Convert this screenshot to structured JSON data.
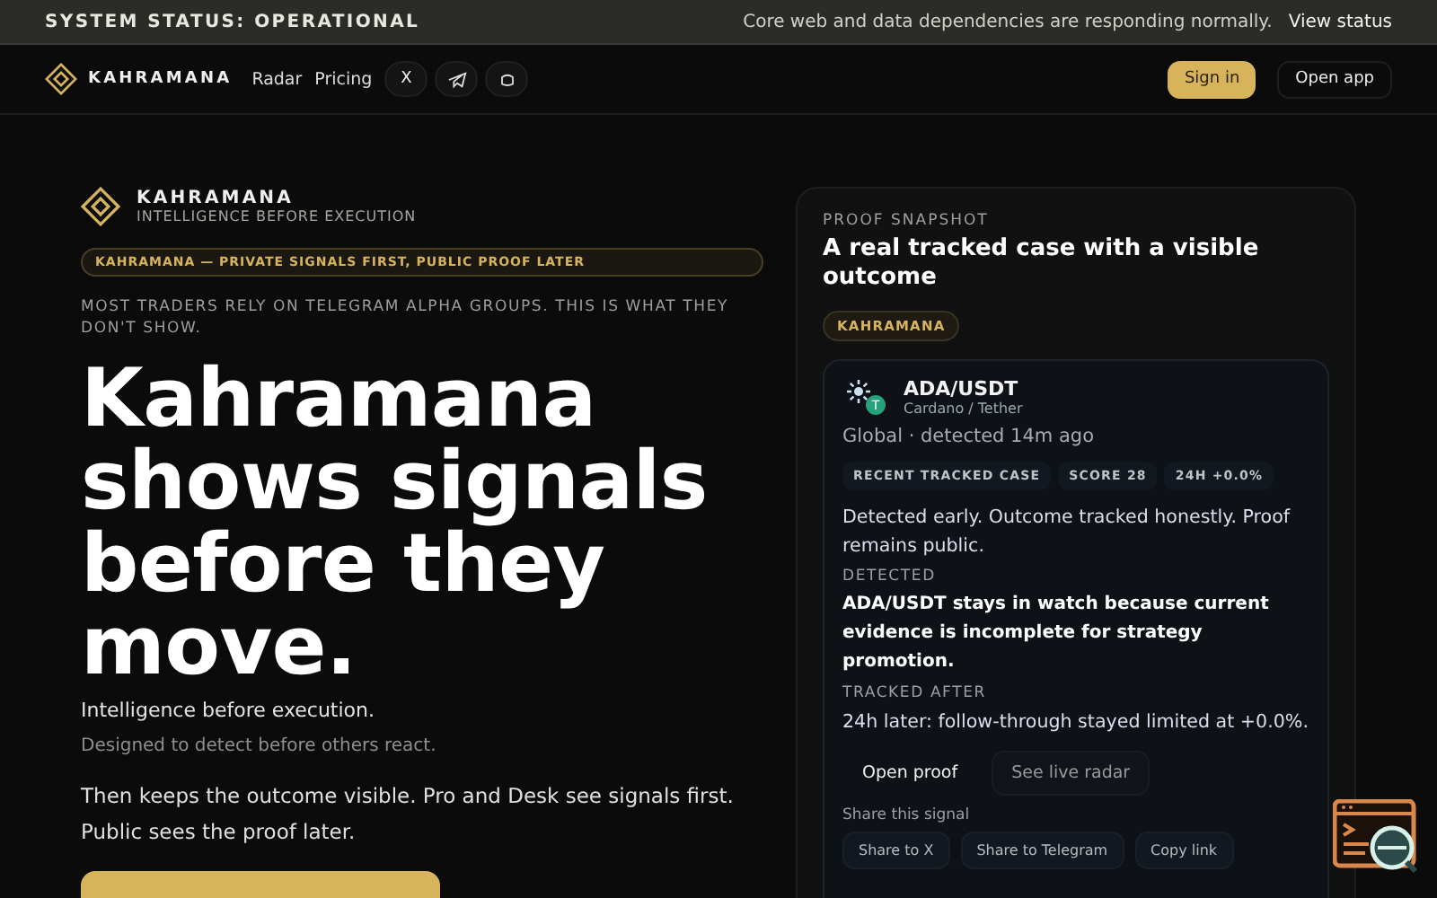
{
  "status_bar": {
    "label": "SYSTEM STATUS: OPERATIONAL",
    "message": "Core web and data dependencies are responding normally.",
    "link": "View status"
  },
  "nav": {
    "brand": "KAHRAMANA",
    "links": [
      "Radar",
      "Pricing"
    ],
    "social": [
      {
        "kind": "x",
        "label": "X"
      },
      {
        "kind": "telegram"
      },
      {
        "kind": "discord"
      }
    ],
    "sign_in": "Sign in",
    "open_app": "Open app"
  },
  "hero": {
    "brand": "KAHRAMANA",
    "tagline": "INTELLIGENCE BEFORE EXECUTION",
    "pill": "KAHRAMANA — PRIVATE SIGNALS FIRST, PUBLIC PROOF LATER",
    "eyebrow": "MOST TRADERS RELY ON TELEGRAM ALPHA GROUPS. THIS IS WHAT THEY DON'T SHOW.",
    "headline": "Kahramana shows signals before they move.",
    "sub": "Intelligence before execution.",
    "note": "Designed to detect before others react.",
    "body": "Then keeps the outcome visible. Pro and Desk see signals first. Public sees the proof later."
  },
  "proof": {
    "eyebrow": "PROOF SNAPSHOT",
    "title": "A real tracked case with a visible outcome",
    "badge": "KAHRAMANA",
    "case": {
      "pair": "ADA/USDT",
      "names": "Cardano / Tether",
      "quote_badge": "T",
      "meta": "Global · detected 14m ago",
      "chips": [
        "RECENT TRACKED CASE",
        "SCORE 28",
        "24H +0.0%"
      ],
      "summary": "Detected early. Outcome tracked honestly. Proof remains public.",
      "sections": [
        {
          "label": "DETECTED",
          "text": "ADA/USDT stays in watch because current evidence is incomplete for strategy promotion.",
          "kind": "strong"
        },
        {
          "label": "TRACKED AFTER",
          "text": "24h later: follow-through stayed limited at +0.0%.",
          "kind": "plain"
        }
      ],
      "actions": [
        {
          "label": "Open proof",
          "selected": true
        },
        {
          "label": "See live radar",
          "selected": false
        }
      ],
      "share_label": "Share this signal",
      "share": [
        "Share to X",
        "Share to Telegram",
        "Copy link"
      ]
    }
  }
}
